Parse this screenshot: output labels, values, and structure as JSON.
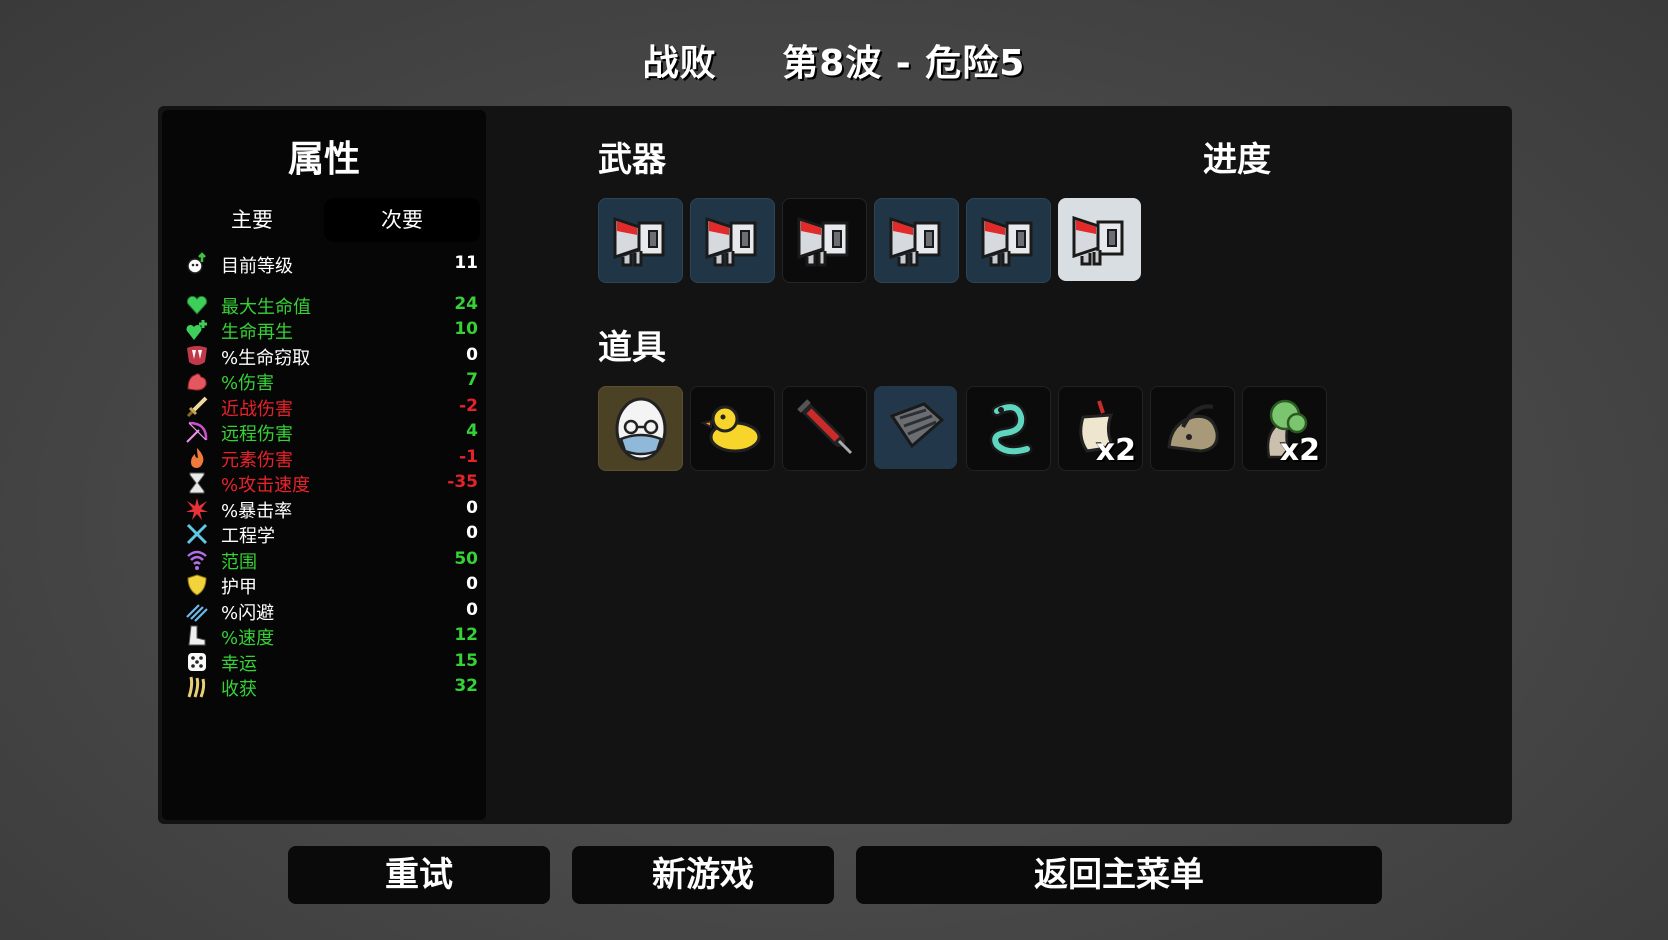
{
  "header": {
    "result": "战败",
    "wave_info": "第8波 - 危险5"
  },
  "stats": {
    "title": "属性",
    "tabs": {
      "primary": "主要",
      "secondary": "次要"
    },
    "rows": [
      {
        "label": "目前等级",
        "value": "11",
        "tone": "neutral",
        "icon": "level-up-icon"
      },
      {
        "label": "最大生命值",
        "value": "24",
        "tone": "pos",
        "icon": "heart-icon"
      },
      {
        "label": "生命再生",
        "value": "10",
        "tone": "pos",
        "icon": "heart-plus-icon"
      },
      {
        "label": "%生命窃取",
        "value": "0",
        "tone": "neutral",
        "icon": "fangs-icon"
      },
      {
        "label": "%伤害",
        "value": "7",
        "tone": "pos",
        "icon": "muscle-icon"
      },
      {
        "label": "近战伤害",
        "value": "-2",
        "tone": "neg",
        "icon": "sword-icon"
      },
      {
        "label": "远程伤害",
        "value": "4",
        "tone": "pos",
        "icon": "bow-icon"
      },
      {
        "label": "元素伤害",
        "value": "-1",
        "tone": "neg",
        "icon": "flame-icon"
      },
      {
        "label": "%攻击速度",
        "value": "-35",
        "tone": "neg",
        "icon": "hourglass-icon"
      },
      {
        "label": "%暴击率",
        "value": "0",
        "tone": "neutral",
        "icon": "crit-burst-icon"
      },
      {
        "label": "工程学",
        "value": "0",
        "tone": "neutral",
        "icon": "wrench-icon"
      },
      {
        "label": "范围",
        "value": "50",
        "tone": "pos",
        "icon": "range-icon"
      },
      {
        "label": "护甲",
        "value": "0",
        "tone": "neutral",
        "icon": "shield-icon"
      },
      {
        "label": "%闪避",
        "value": "0",
        "tone": "neutral",
        "icon": "dodge-icon"
      },
      {
        "label": "%速度",
        "value": "12",
        "tone": "pos",
        "icon": "boot-icon"
      },
      {
        "label": "幸运",
        "value": "15",
        "tone": "pos",
        "icon": "dice-icon"
      },
      {
        "label": "收获",
        "value": "32",
        "tone": "pos",
        "icon": "harvest-icon"
      }
    ]
  },
  "weapons": {
    "heading": "武器",
    "slots": [
      {
        "icon": "megaphone-weapon-icon",
        "tier": "blue"
      },
      {
        "icon": "megaphone-weapon-icon",
        "tier": "blue"
      },
      {
        "icon": "megaphone-weapon-icon",
        "tier": "dark"
      },
      {
        "icon": "megaphone-weapon-icon",
        "tier": "blue"
      },
      {
        "icon": "megaphone-weapon-icon",
        "tier": "blue"
      },
      {
        "icon": "megaphone-weapon-icon",
        "tier": "light"
      }
    ]
  },
  "progress": {
    "heading": "进度"
  },
  "items": {
    "heading": "道具",
    "slots": [
      {
        "icon": "egg-mask-item-icon",
        "tier": "olive",
        "count": ""
      },
      {
        "icon": "rubber-duck-item-icon",
        "tier": "itemdark",
        "count": ""
      },
      {
        "icon": "syringe-item-icon",
        "tier": "itemdark",
        "count": ""
      },
      {
        "icon": "armor-plate-item-icon",
        "tier": "itemblue",
        "count": ""
      },
      {
        "icon": "alien-worm-item-icon",
        "tier": "itemdark",
        "count": ""
      },
      {
        "icon": "scroll-item-icon",
        "tier": "itemdark",
        "count": "x2"
      },
      {
        "icon": "snail-item-icon",
        "tier": "itemdark",
        "count": ""
      },
      {
        "icon": "tree-item-icon",
        "tier": "itemdark",
        "count": "x2"
      }
    ]
  },
  "buttons": {
    "retry": "重试",
    "new_game": "新游戏",
    "main_menu": "返回主菜单"
  }
}
